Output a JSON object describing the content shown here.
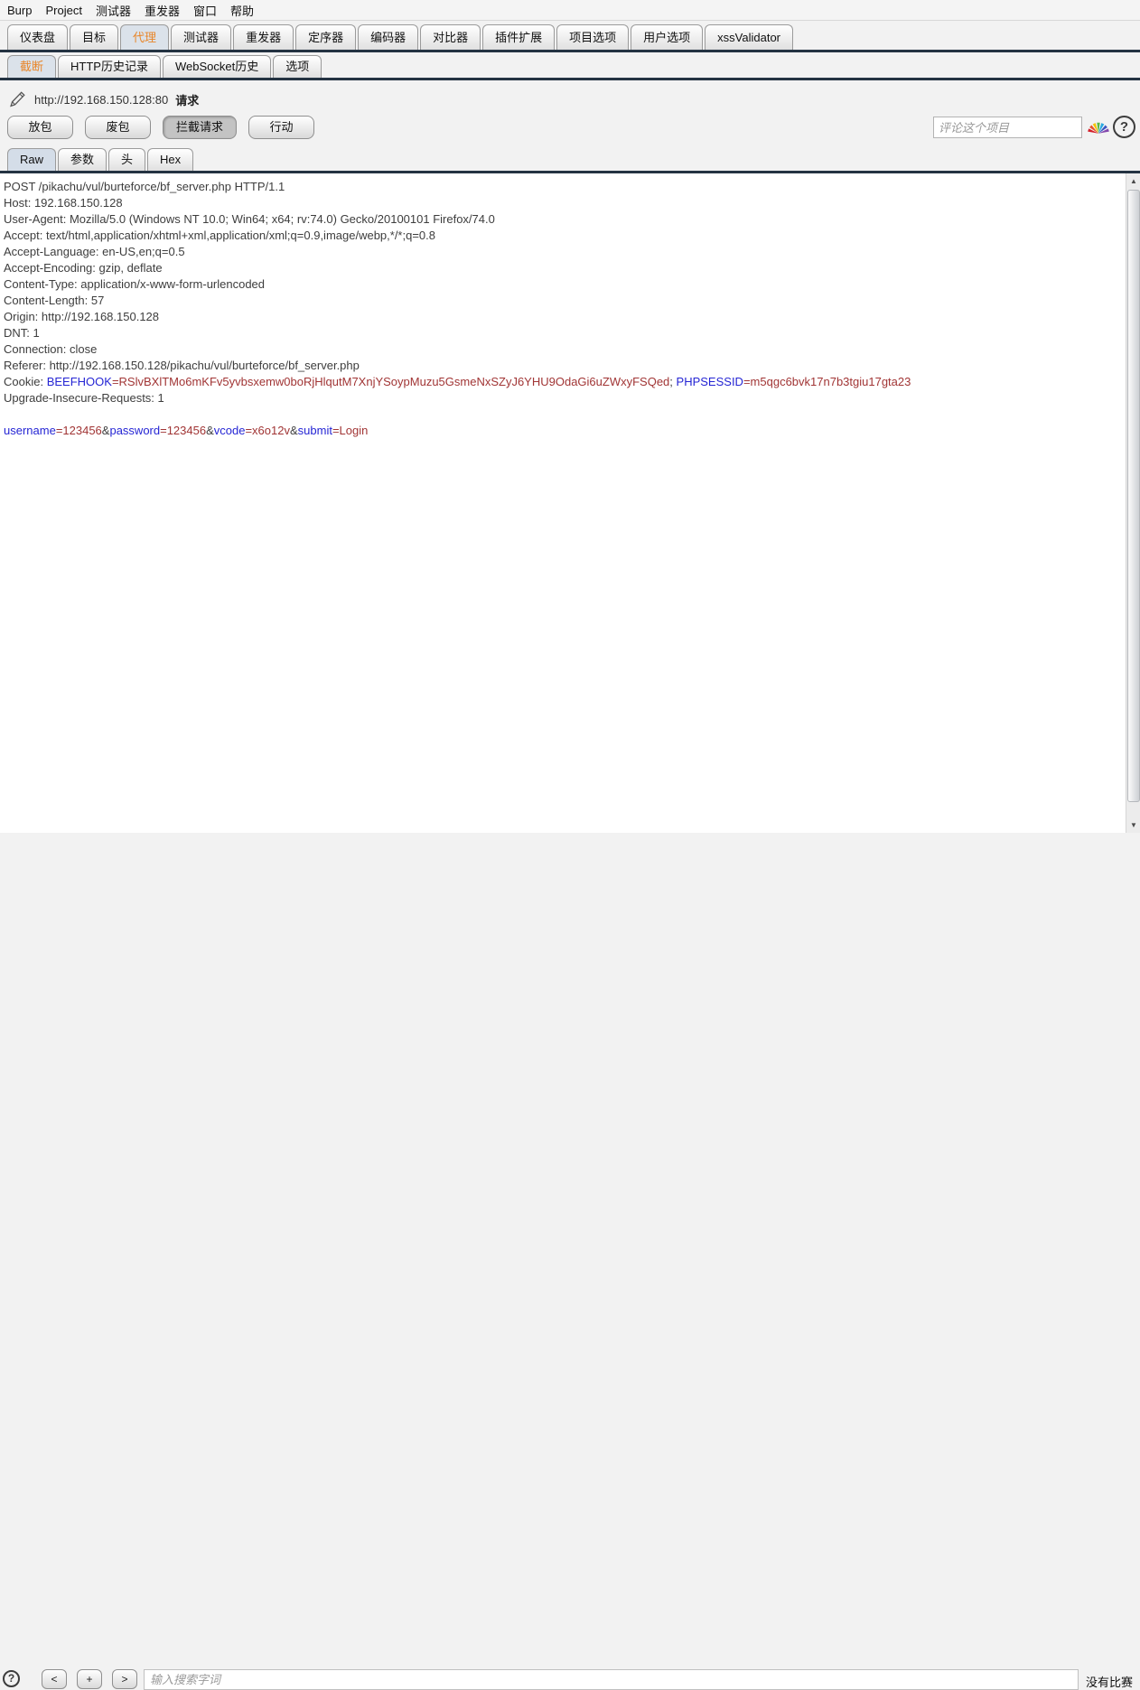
{
  "menu_bar": {
    "items": [
      "Burp",
      "Project",
      "测试器",
      "重发器",
      "窗口",
      "帮助"
    ]
  },
  "main_tabs": [
    {
      "label": "仪表盘"
    },
    {
      "label": "目标"
    },
    {
      "label": "代理",
      "selected": true
    },
    {
      "label": "测试器"
    },
    {
      "label": "重发器"
    },
    {
      "label": "定序器"
    },
    {
      "label": "编码器"
    },
    {
      "label": "对比器"
    },
    {
      "label": "插件扩展"
    },
    {
      "label": "项目选项"
    },
    {
      "label": "用户选项"
    },
    {
      "label": "xssValidator"
    }
  ],
  "proxy_tabs": [
    {
      "label": "截断",
      "selected": true
    },
    {
      "label": "HTTP历史记录"
    },
    {
      "label": "WebSocket历史"
    },
    {
      "label": "选项"
    }
  ],
  "intercept": {
    "url": "http://192.168.150.128:80",
    "request_label": "请求",
    "forward_button": "放包",
    "drop_button": "废包",
    "intercept_toggle_button": "拦截请求",
    "action_button": "行动",
    "comment_placeholder": "评论这个项目",
    "help_label": "?"
  },
  "message_tabs": [
    {
      "label": "Raw",
      "selected": true
    },
    {
      "label": "参数"
    },
    {
      "label": "头"
    },
    {
      "label": "Hex"
    }
  ],
  "request": {
    "lines": [
      [
        [
          "POST /pikachu/vul/burteforce/bf_server.php HTTP/1.1",
          "p"
        ]
      ],
      [
        [
          "Host: 192.168.150.128",
          "p"
        ]
      ],
      [
        [
          "User-Agent: Mozilla/5.0 (Windows NT 10.0; Win64; x64; rv:74.0) Gecko/20100101 Firefox/74.0",
          "p"
        ]
      ],
      [
        [
          "Accept: text/html,application/xhtml+xml,application/xml;q=0.9,image/webp,*/*;q=0.8",
          "p"
        ]
      ],
      [
        [
          "Accept-Language: en-US,en;q=0.5",
          "p"
        ]
      ],
      [
        [
          "Accept-Encoding: gzip, deflate",
          "p"
        ]
      ],
      [
        [
          "Content-Type: application/x-www-form-urlencoded",
          "p"
        ]
      ],
      [
        [
          "Content-Length: 57",
          "p"
        ]
      ],
      [
        [
          "Origin: http://192.168.150.128",
          "p"
        ]
      ],
      [
        [
          "DNT: 1",
          "p"
        ]
      ],
      [
        [
          "Connection: close",
          "p"
        ]
      ],
      [
        [
          "Referer: http://192.168.150.128/pikachu/vul/burteforce/bf_server.php",
          "p"
        ]
      ],
      [
        [
          "Cookie: ",
          "p"
        ],
        [
          "BEEFHOOK",
          "n"
        ],
        [
          "=RSlvBXlTMo6mKFv5yvbsxemw0boRjHlqutM7XnjYSoypMuzu5GsmeNxSZyJ6YHU9OdaGi6uZWxyFSQed",
          "v"
        ],
        [
          "; ",
          "p"
        ],
        [
          "PHPSESSID",
          "n"
        ],
        [
          "=m5qgc6bvk17n7b3tgiu17gta23",
          "v"
        ]
      ],
      [
        [
          "Upgrade-Insecure-Requests: 1",
          "p"
        ]
      ],
      [
        [
          "",
          "p"
        ]
      ],
      [
        [
          "username",
          "n"
        ],
        [
          "=123456",
          "v"
        ],
        [
          "&",
          "p"
        ],
        [
          "password",
          "n"
        ],
        [
          "=123456",
          "v"
        ],
        [
          "&",
          "p"
        ],
        [
          "vcode",
          "n"
        ],
        [
          "=x6o12v",
          "v"
        ],
        [
          "&",
          "p"
        ],
        [
          "submit",
          "n"
        ],
        [
          "=Login",
          "v"
        ]
      ]
    ]
  },
  "scrollbar": {
    "up_glyph": "▲",
    "down_glyph": "▼"
  },
  "search_bar": {
    "help_label": "?",
    "prev_button": "<",
    "plus_button": "+",
    "next_button": ">",
    "placeholder": "输入搜索字词",
    "status": "没有比赛"
  },
  "colors": {
    "accent_orange": "#e8862a",
    "tab_underline": "#243342",
    "param_name": "#2525d4",
    "param_value": "#a13535",
    "plain_text": "#3d3d3d"
  }
}
